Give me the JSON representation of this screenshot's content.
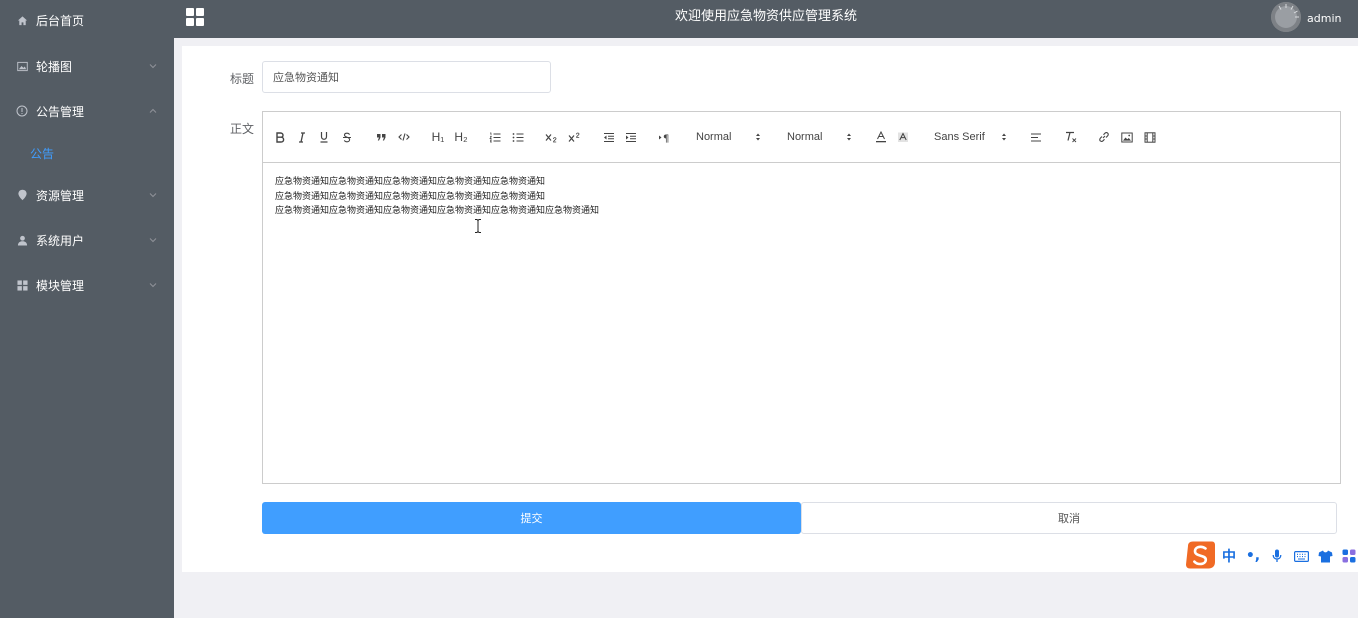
{
  "sidebar": {
    "items": [
      {
        "label": "后台首页",
        "icon": "home-icon"
      },
      {
        "label": "轮播图",
        "icon": "picture-icon"
      },
      {
        "label": "公告管理",
        "icon": "info-icon"
      },
      {
        "label": "资源管理",
        "icon": "location-icon"
      },
      {
        "label": "系统用户",
        "icon": "user-icon"
      },
      {
        "label": "模块管理",
        "icon": "grid-icon"
      }
    ],
    "sub_items": [
      {
        "label": "公告"
      }
    ]
  },
  "header": {
    "title": "欢迎使用应急物资供应管理系统",
    "username": "admin"
  },
  "form": {
    "title_label": "标题",
    "title_value": "应急物资通知",
    "body_label": "正文",
    "body_lines": [
      "应急物资通知应急物资通知应急物资通知应急物资通知应急物资通知",
      "应急物资通知应急物资通知应急物资通知应急物资通知应急物资通知",
      "应急物资通知应急物资通知应急物资通知应急物资通知应急物资通知应急物资通知"
    ],
    "submit_label": "提交",
    "cancel_label": "取消"
  },
  "toolbar": {
    "header_select": "Normal",
    "size_select": "Normal",
    "font_select": "Sans Serif",
    "h1": "H₁",
    "h2": "H₂"
  },
  "ime": {
    "lang": "中",
    "punct": "•,"
  },
  "colors": {
    "sidebar_bg": "#545c64",
    "accent": "#409eff"
  }
}
